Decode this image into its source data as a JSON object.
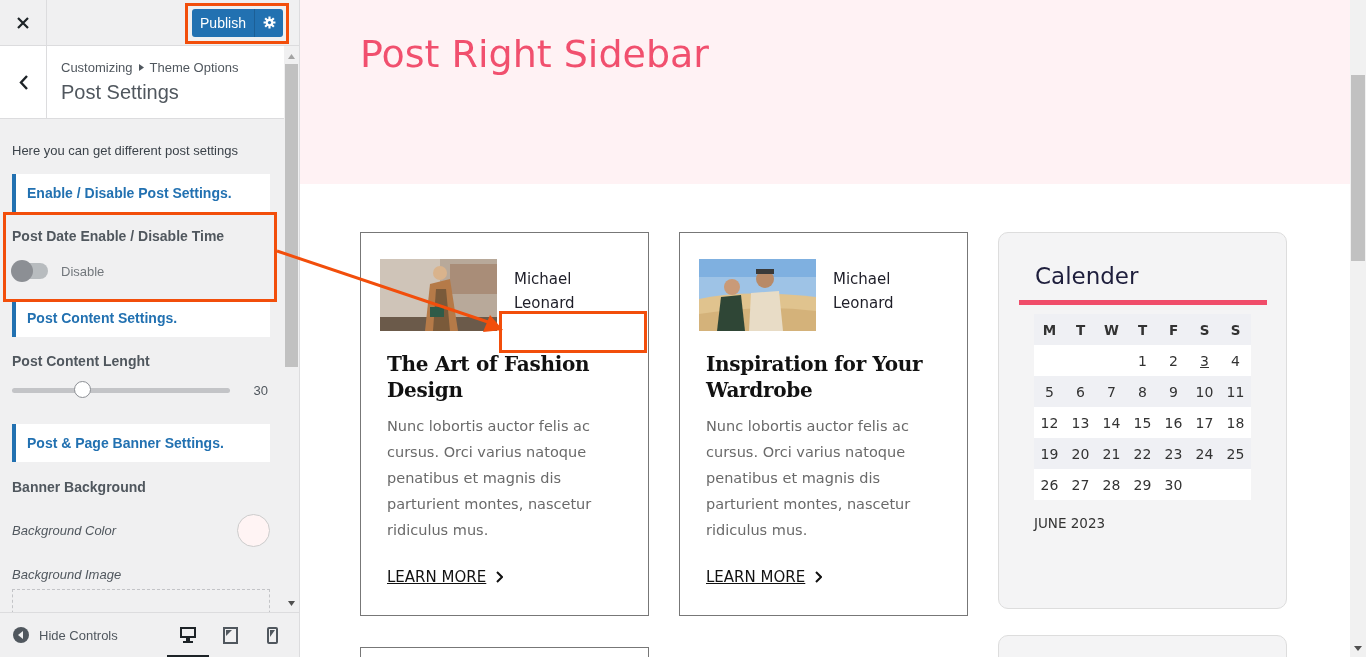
{
  "sidebar": {
    "publish_button": "Publish",
    "breadcrumb": [
      "Customizing",
      "Theme Options"
    ],
    "section_title": "Post Settings",
    "description": "Here you can get different post settings",
    "controls": [
      {
        "kind": "heading",
        "label": "Enable / Disable Post Settings."
      },
      {
        "kind": "toggle",
        "label": "Post Date Enable / Disable Time",
        "on": false,
        "state_text": "Disable"
      },
      {
        "kind": "heading",
        "label": "Post Content Settings."
      },
      {
        "kind": "slider",
        "label": "Post Content Lenght",
        "level": 0.32,
        "reading": "30"
      },
      {
        "kind": "heading",
        "label": "Post & Page Banner Settings."
      },
      {
        "kind": "group",
        "label": "Banner Background"
      },
      {
        "kind": "color",
        "label": "Background Color"
      },
      {
        "label": "Background Image"
      }
    ],
    "footer": {
      "hide_controls": "Hide Controls",
      "devices": [
        {
          "kind": "desktop",
          "selected": true
        },
        {
          "kind": "tablet",
          "selected": false
        },
        {
          "kind": "mobile",
          "selected": false
        }
      ]
    }
  },
  "preview": {
    "banner_title": "Post Right Sidebar",
    "posts": [
      {
        "author": "Michael Leonard",
        "title": "The Art of Fashion Design",
        "excerpt": "Nunc lobortis auctor felis ac cursus. Orci varius natoque penatibus et magnis dis parturient montes, nascetur ridiculus mus.",
        "link": "LEARN MORE"
      },
      {
        "author": "Michael Leonard",
        "title": "Inspiration for Your Wardrobe",
        "excerpt": "Nunc lobortis auctor felis ac cursus. Orci varius natoque penatibus et magnis dis parturient montes, nascetur ridiculus mus.",
        "link": "LEARN MORE"
      }
    ],
    "calendar": {
      "title": "Calender",
      "weekdays": [
        "M",
        "T",
        "W",
        "T",
        "F",
        "S",
        "S"
      ],
      "weeks": [
        {
          "kind": "first",
          "days": [
            {
              "day": "1",
              "linked": false
            },
            {
              "day": "2",
              "linked": false
            },
            {
              "day": "3",
              "linked": true
            },
            {
              "day": "4",
              "linked": false
            }
          ]
        },
        {
          "kind": "full",
          "days": [
            {
              "day": "5",
              "linked": false
            },
            {
              "day": "6",
              "linked": false
            },
            {
              "day": "7",
              "linked": false
            },
            {
              "day": "8",
              "linked": false
            },
            {
              "day": "9",
              "linked": false
            },
            {
              "day": "10",
              "linked": false
            },
            {
              "day": "11",
              "linked": false
            }
          ]
        },
        {
          "kind": "full",
          "days": [
            {
              "day": "12",
              "linked": false
            },
            {
              "day": "13",
              "linked": false
            },
            {
              "day": "14",
              "linked": false
            },
            {
              "day": "15",
              "linked": false
            },
            {
              "day": "16",
              "linked": false
            },
            {
              "day": "17",
              "linked": false
            },
            {
              "day": "18",
              "linked": false
            }
          ]
        },
        {
          "kind": "full",
          "days": [
            {
              "day": "19",
              "linked": false
            },
            {
              "day": "20",
              "linked": false
            },
            {
              "day": "21",
              "linked": false
            },
            {
              "day": "22",
              "linked": false
            },
            {
              "day": "23",
              "linked": false
            },
            {
              "day": "24",
              "linked": false
            },
            {
              "day": "25",
              "linked": false
            }
          ]
        },
        {
          "kind": "last",
          "days": [
            {
              "day": "26",
              "linked": false
            },
            {
              "day": "27",
              "linked": false
            },
            {
              "day": "28",
              "linked": false
            },
            {
              "day": "29",
              "linked": false
            },
            {
              "day": "30",
              "linked": false
            }
          ]
        }
      ],
      "caption": "JUNE 2023"
    }
  }
}
